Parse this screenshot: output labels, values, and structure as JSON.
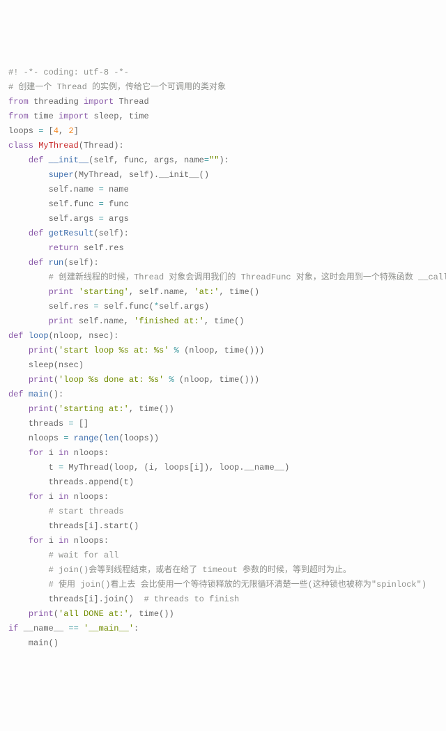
{
  "lines": [
    [
      [
        "cm",
        "#! -*- coding: utf-8 -*-"
      ]
    ],
    [
      [
        "cm",
        "# 创建一个 Thread 的实例，传给它一个可调用的类对象"
      ]
    ],
    [
      [
        "kw",
        "from"
      ],
      [
        "",
        " threading "
      ],
      [
        "kw",
        "import"
      ],
      [
        "",
        " Thread"
      ]
    ],
    [
      [
        "kw",
        "from"
      ],
      [
        "",
        " time "
      ],
      [
        "kw",
        "import"
      ],
      [
        "",
        " sleep, time"
      ]
    ],
    [
      [
        "",
        "loops "
      ],
      [
        "op",
        "="
      ],
      [
        "",
        " ["
      ],
      [
        "nm",
        "4"
      ],
      [
        "",
        ", "
      ],
      [
        "nm",
        "2"
      ],
      [
        "",
        "]"
      ]
    ],
    [
      [
        "kw",
        "class"
      ],
      [
        "",
        " "
      ],
      [
        "cls",
        "MyThread"
      ],
      [
        "",
        "(Thread):"
      ]
    ],
    [
      [
        "",
        "    "
      ],
      [
        "kw",
        "def"
      ],
      [
        "",
        " "
      ],
      [
        "fn",
        "__init__"
      ],
      [
        "",
        "(self, func, args, name"
      ],
      [
        "op",
        "="
      ],
      [
        "st",
        "\"\""
      ],
      [
        "",
        "):"
      ]
    ],
    [
      [
        "",
        "        "
      ],
      [
        "bi",
        "super"
      ],
      [
        "",
        "(MyThread, self).__init__()"
      ]
    ],
    [
      [
        "",
        "        self.name "
      ],
      [
        "op",
        "="
      ],
      [
        "",
        " name"
      ]
    ],
    [
      [
        "",
        "        self.func "
      ],
      [
        "op",
        "="
      ],
      [
        "",
        " func"
      ]
    ],
    [
      [
        "",
        "        self.args "
      ],
      [
        "op",
        "="
      ],
      [
        "",
        " args"
      ]
    ],
    [
      [
        "",
        "    "
      ],
      [
        "kw",
        "def"
      ],
      [
        "",
        " "
      ],
      [
        "fn",
        "getResult"
      ],
      [
        "",
        "(self):"
      ]
    ],
    [
      [
        "",
        "        "
      ],
      [
        "kw",
        "return"
      ],
      [
        "",
        " self.res"
      ]
    ],
    [
      [
        "",
        "    "
      ],
      [
        "kw",
        "def"
      ],
      [
        "",
        " "
      ],
      [
        "fn",
        "run"
      ],
      [
        "",
        "(self):"
      ]
    ],
    [
      [
        "",
        "        "
      ],
      [
        "cm",
        "# 创建新线程的时候，Thread 对象会调用我们的 ThreadFunc 对象，这时会用到一个特殊函数 __call__()。"
      ]
    ],
    [
      [
        "",
        "        "
      ],
      [
        "kw",
        "print"
      ],
      [
        "",
        " "
      ],
      [
        "st",
        "'starting'"
      ],
      [
        "",
        ", self.name, "
      ],
      [
        "st",
        "'at:'"
      ],
      [
        "",
        ", time()"
      ]
    ],
    [
      [
        "",
        "        self.res "
      ],
      [
        "op",
        "="
      ],
      [
        "",
        " self.func("
      ],
      [
        "op",
        "*"
      ],
      [
        "",
        "self.args)"
      ]
    ],
    [
      [
        "",
        "        "
      ],
      [
        "kw",
        "print"
      ],
      [
        "",
        " self.name, "
      ],
      [
        "st",
        "'finished at:'"
      ],
      [
        "",
        ", time()"
      ]
    ],
    [
      [
        "kw",
        "def"
      ],
      [
        "",
        " "
      ],
      [
        "fn",
        "loop"
      ],
      [
        "",
        "(nloop, nsec):"
      ]
    ],
    [
      [
        "",
        "    "
      ],
      [
        "kw",
        "print"
      ],
      [
        "",
        "("
      ],
      [
        "st",
        "'start loop %s at: %s'"
      ],
      [
        "",
        " "
      ],
      [
        "op",
        "%"
      ],
      [
        "",
        " (nloop, time()))"
      ]
    ],
    [
      [
        "",
        "    sleep(nsec)"
      ]
    ],
    [
      [
        "",
        "    "
      ],
      [
        "kw",
        "print"
      ],
      [
        "",
        "("
      ],
      [
        "st",
        "'loop %s done at: %s'"
      ],
      [
        "",
        " "
      ],
      [
        "op",
        "%"
      ],
      [
        "",
        " (nloop, time()))"
      ]
    ],
    [
      [
        "kw",
        "def"
      ],
      [
        "",
        " "
      ],
      [
        "fn",
        "main"
      ],
      [
        "",
        "():"
      ]
    ],
    [
      [
        "",
        "    "
      ],
      [
        "kw",
        "print"
      ],
      [
        "",
        "("
      ],
      [
        "st",
        "'starting at:'"
      ],
      [
        "",
        ", time())"
      ]
    ],
    [
      [
        "",
        "    threads "
      ],
      [
        "op",
        "="
      ],
      [
        "",
        " []"
      ]
    ],
    [
      [
        "",
        "    nloops "
      ],
      [
        "op",
        "="
      ],
      [
        "",
        " "
      ],
      [
        "bi",
        "range"
      ],
      [
        "",
        "("
      ],
      [
        "bi",
        "len"
      ],
      [
        "",
        "(loops))"
      ]
    ],
    [
      [
        "",
        "    "
      ],
      [
        "kw",
        "for"
      ],
      [
        "",
        " i "
      ],
      [
        "kw",
        "in"
      ],
      [
        "",
        " nloops:"
      ]
    ],
    [
      [
        "",
        "        t "
      ],
      [
        "op",
        "="
      ],
      [
        "",
        " MyThread(loop, (i, loops[i]), loop.__name__)"
      ]
    ],
    [
      [
        "",
        "        threads.append(t)"
      ]
    ],
    [
      [
        "",
        "    "
      ],
      [
        "kw",
        "for"
      ],
      [
        "",
        " i "
      ],
      [
        "kw",
        "in"
      ],
      [
        "",
        " nloops:"
      ]
    ],
    [
      [
        "",
        "        "
      ],
      [
        "cm",
        "# start threads"
      ]
    ],
    [
      [
        "",
        "        threads[i].start()"
      ]
    ],
    [
      [
        "",
        "    "
      ],
      [
        "kw",
        "for"
      ],
      [
        "",
        " i "
      ],
      [
        "kw",
        "in"
      ],
      [
        "",
        " nloops:"
      ]
    ],
    [
      [
        "",
        "        "
      ],
      [
        "cm",
        "# wait for all"
      ]
    ],
    [
      [
        "",
        "        "
      ],
      [
        "cm",
        "# join()会等到线程结束，或者在给了 timeout 参数的时候，等到超时为止。"
      ]
    ],
    [
      [
        "",
        "        "
      ],
      [
        "cm",
        "# 使用 join()看上去 会比使用一个等待锁释放的无限循环清楚一些(这种锁也被称为\"spinlock\")"
      ]
    ],
    [
      [
        "",
        "        threads[i].join()  "
      ],
      [
        "cm",
        "# threads to finish"
      ]
    ],
    [
      [
        "",
        "    "
      ],
      [
        "kw",
        "print"
      ],
      [
        "",
        "("
      ],
      [
        "st",
        "'all DONE at:'"
      ],
      [
        "",
        ", time())"
      ]
    ],
    [
      [
        "kw",
        "if"
      ],
      [
        "",
        " __name__ "
      ],
      [
        "op",
        "=="
      ],
      [
        "",
        " "
      ],
      [
        "st",
        "'__main__'"
      ],
      [
        "",
        ":"
      ]
    ],
    [
      [
        "",
        "    main()"
      ]
    ]
  ]
}
